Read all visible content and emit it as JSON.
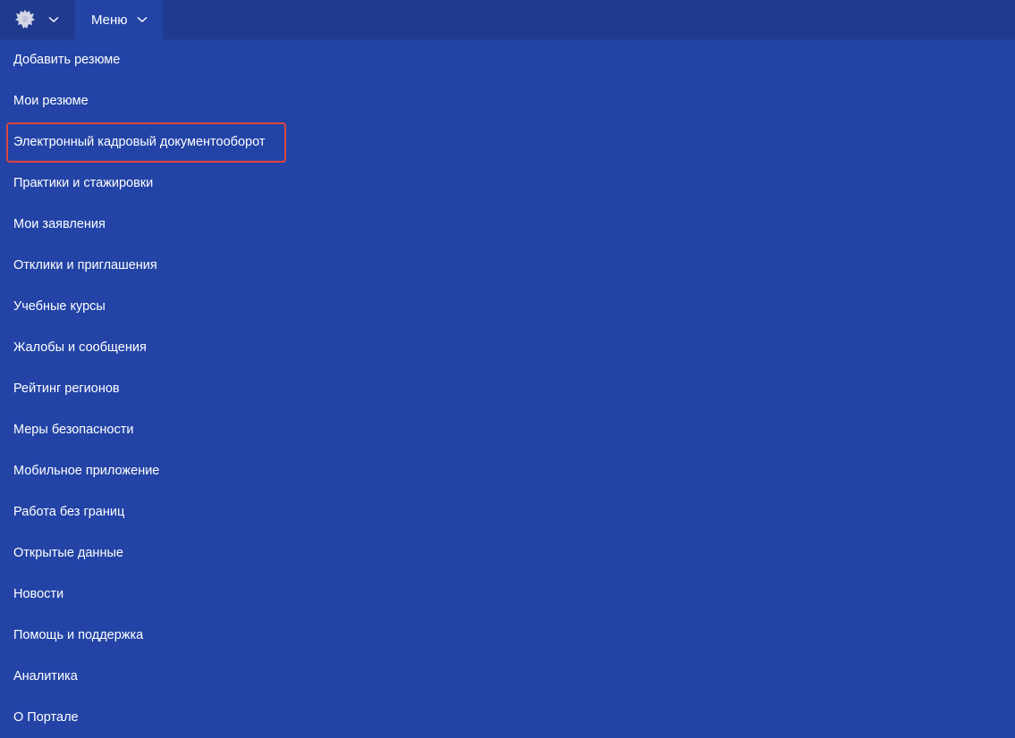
{
  "header": {
    "emblem_icon": "russian-coat-of-arms-icon",
    "menu_label": "Меню"
  },
  "menu": {
    "items": [
      {
        "label": "Добавить резюме"
      },
      {
        "label": "Мои резюме"
      },
      {
        "label": "Электронный кадровый документооборот",
        "highlighted": true
      },
      {
        "label": "Практики и стажировки"
      },
      {
        "label": "Мои заявления"
      },
      {
        "label": "Отклики и приглашения"
      },
      {
        "label": "Учебные курсы"
      },
      {
        "label": "Жалобы и сообщения"
      },
      {
        "label": "Рейтинг регионов"
      },
      {
        "label": "Меры безопасности"
      },
      {
        "label": "Мобильное приложение"
      },
      {
        "label": "Работа без границ"
      },
      {
        "label": "Открытые данные"
      },
      {
        "label": "Новости"
      },
      {
        "label": "Помощь и поддержка"
      },
      {
        "label": "Аналитика"
      },
      {
        "label": "О Портале"
      }
    ]
  },
  "colors": {
    "background": "#2344a6",
    "topbar": "#1f3a8f",
    "highlight_border": "#e0443a"
  }
}
